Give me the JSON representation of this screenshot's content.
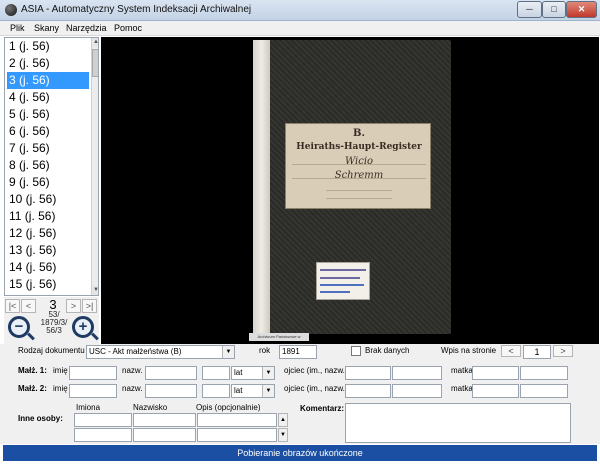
{
  "window": {
    "title": "ASIA - Automatyczny System Indeksacji Archiwalnej",
    "min_label": "─",
    "max_label": "□",
    "close_label": "✕"
  },
  "menu": {
    "items": [
      "Plik",
      "Skany",
      "Narzędzia",
      "Pomoc"
    ]
  },
  "file_list": {
    "items": [
      "1 (j. 56)",
      "2 (j. 56)",
      "3 (j. 56)",
      "4 (j. 56)",
      "5 (j. 56)",
      "6 (j. 56)",
      "7 (j. 56)",
      "8 (j. 56)",
      "9 (j. 56)",
      "10 (j. 56)",
      "11 (j. 56)",
      "12 (j. 56)",
      "13 (j. 56)",
      "14 (j. 56)",
      "15 (j. 56)"
    ],
    "selected_index": 2,
    "scroll_up": "▲",
    "scroll_down": "▼"
  },
  "nav": {
    "first": "|<",
    "prev": "<",
    "next": ">",
    "last": ">|",
    "page": "3",
    "signature_1": "53/",
    "signature_2": "1879/3/",
    "signature_3": "56/3",
    "zoom_out": "−",
    "zoom_in": "+"
  },
  "image": {
    "label_letter": "B.",
    "label_title": "Heiraths-Haupt-Register",
    "label_line_1": "Wicio",
    "label_line_2": "Schremm",
    "watermark": "Archiwum Państwowe w Poznaniu"
  },
  "form": {
    "doc_type_label": "Rodzaj dokumentu",
    "doc_type_value": "USC - Akt małżeństwa (B)",
    "year_label": "rok",
    "year_value": "1891",
    "no_data_label": "Brak danych",
    "entry_on_page_label": "Wpis na stronie",
    "entry_value": "1",
    "prev_btn": "<",
    "next_btn": ">",
    "spouse1_label": "Małż. 1:",
    "spouse2_label": "Małż. 2:",
    "first_name_label": "imię",
    "surname_label": "nazw.",
    "age_unit": "lat",
    "father_label": "ojciec (im., nazw.)",
    "mother_label": "matka",
    "other_people_label": "Inne osoby:",
    "col_first": "Imiona",
    "col_surname": "Nazwisko",
    "col_desc": "Opis (opcjonalnie)",
    "comment_label": "Komentarz:"
  },
  "status": {
    "text": "Pobieranie obrazów ukończone"
  }
}
